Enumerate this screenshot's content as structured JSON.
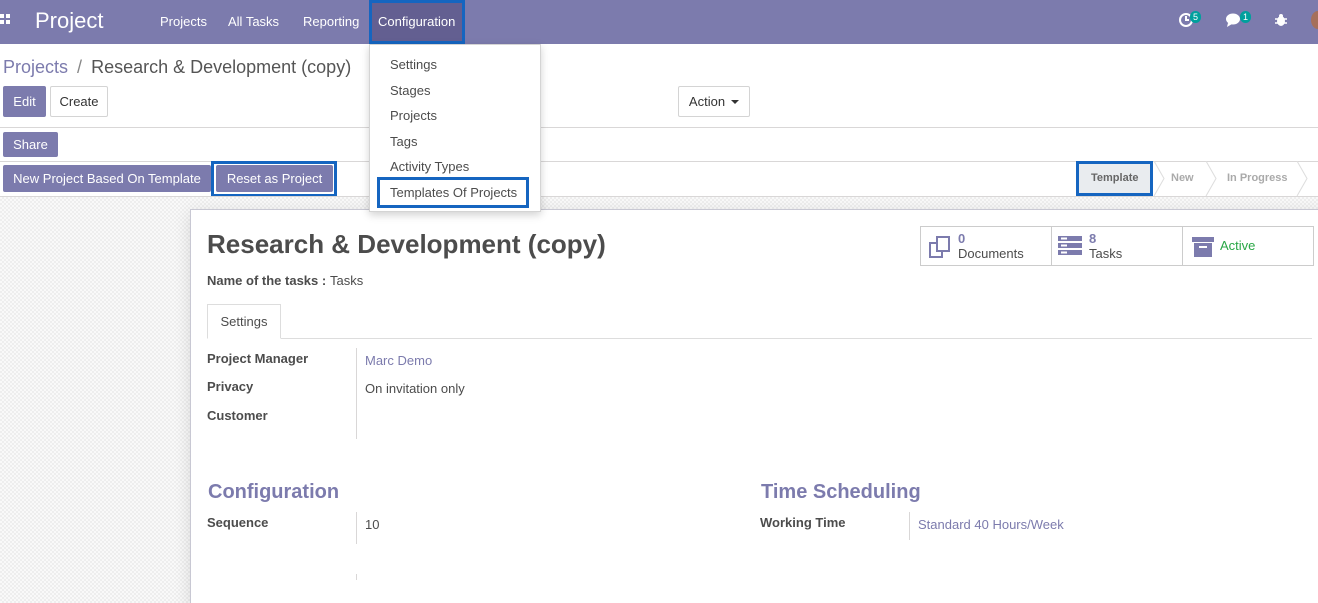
{
  "navbar": {
    "brand": "Project",
    "menu": [
      "Projects",
      "All Tasks",
      "Reporting",
      "Configuration"
    ],
    "activities_count": "5",
    "messages_count": "1"
  },
  "config_menu": {
    "items": [
      "Settings",
      "Stages",
      "Projects",
      "Tags",
      "Activity Types",
      "Templates Of Projects"
    ]
  },
  "breadcrumb": {
    "parent": "Projects",
    "separator": "/",
    "current": "Research & Development (copy)"
  },
  "buttons": {
    "edit": "Edit",
    "create": "Create",
    "action": "Action",
    "share": "Share",
    "new_from_template": "New Project Based On Template",
    "reset_as_project": "Reset as Project"
  },
  "statusbar": {
    "stages": [
      "Template",
      "New",
      "In Progress"
    ],
    "current": "Template"
  },
  "record": {
    "title": "Research & Development (copy)",
    "tasks_name_label": "Name of the tasks :",
    "tasks_name_value": "Tasks"
  },
  "smart_buttons": {
    "documents_count": "0",
    "documents_label": "Documents",
    "tasks_count": "8",
    "tasks_label": "Tasks",
    "active_label": "Active"
  },
  "tabs": [
    "Settings"
  ],
  "settings_fields": {
    "project_manager_label": "Project Manager",
    "project_manager_value": "Marc Demo",
    "privacy_label": "Privacy",
    "privacy_value": "On invitation only",
    "customer_label": "Customer",
    "customer_value": ""
  },
  "configuration": {
    "title": "Configuration",
    "sequence_label": "Sequence",
    "sequence_value": "10"
  },
  "time_scheduling": {
    "title": "Time Scheduling",
    "working_time_label": "Working Time",
    "working_time_value": "Standard 40 Hours/Week"
  },
  "colors": {
    "brand": "#7c7bad",
    "highlight": "#1565c0",
    "active_green": "#28a745"
  }
}
